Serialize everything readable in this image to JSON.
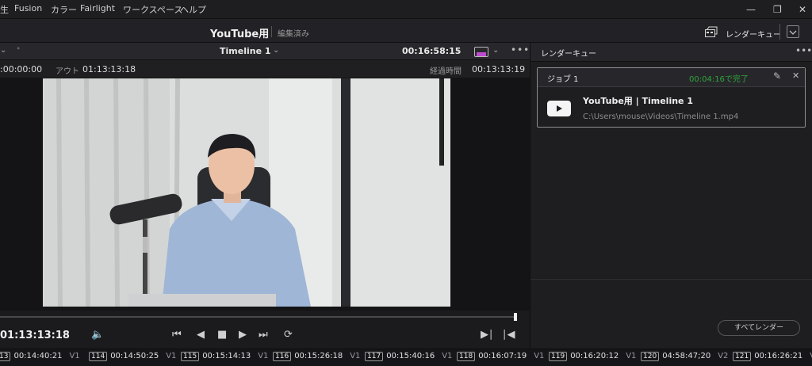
{
  "menubar": {
    "items": [
      "生",
      "Fusion",
      "カラー",
      "Fairlight",
      "ワークスペース",
      "ヘルプ"
    ]
  },
  "window_controls": [
    "minimize",
    "restore",
    "close"
  ],
  "project": {
    "title": "YouTube用",
    "status": "編集済み"
  },
  "header": {
    "render_queue_label": "レンダーキュー"
  },
  "viewer": {
    "timeline_name": "Timeline 1",
    "current_timecode": "00:16:58:15",
    "in_label": "",
    "in_timecode": ":00:00:00",
    "out_label": "アウト",
    "out_timecode": "01:13:13:18",
    "duration_label": "経過時間",
    "duration_timecode": "00:13:13:19",
    "playhead_timecode": "01:13:13:18",
    "scrub_position_fraction": 0.97
  },
  "transport": {
    "icons": [
      "volume-icon",
      "first-frame-icon",
      "reverse-icon",
      "stop-icon",
      "play-icon",
      "last-frame-icon",
      "loop-icon",
      "mark-in-icon",
      "mark-out-icon"
    ]
  },
  "render_queue": {
    "header_label": "レンダーキュー",
    "job": {
      "label": "ジョブ 1",
      "status": "00:04:16で完了",
      "title": "YouTube用 | Timeline 1",
      "path": "C:\\Users\\mouse\\Videos\\Timeline 1.mp4"
    },
    "render_all_label": "すべてレンダー"
  },
  "colors": {
    "accent_green": "#2fa43a",
    "panel_bg": "#1e1e21"
  },
  "clips": [
    {
      "num": "13",
      "tc": "00:14:40:21",
      "track": "V1"
    },
    {
      "num": "114",
      "tc": "00:14:50:25",
      "track": "V1"
    },
    {
      "num": "115",
      "tc": "00:15:14:13",
      "track": "V1"
    },
    {
      "num": "116",
      "tc": "00:15:26:18",
      "track": "V1"
    },
    {
      "num": "117",
      "tc": "00:15:40:16",
      "track": "V1"
    },
    {
      "num": "118",
      "tc": "00:16:07:19",
      "track": "V1"
    },
    {
      "num": "119",
      "tc": "00:16:20:12",
      "track": "V1"
    },
    {
      "num": "120",
      "tc": "04:58:47;20",
      "track": "V2"
    },
    {
      "num": "121",
      "tc": "00:16:26:21",
      "track": "V1"
    }
  ]
}
